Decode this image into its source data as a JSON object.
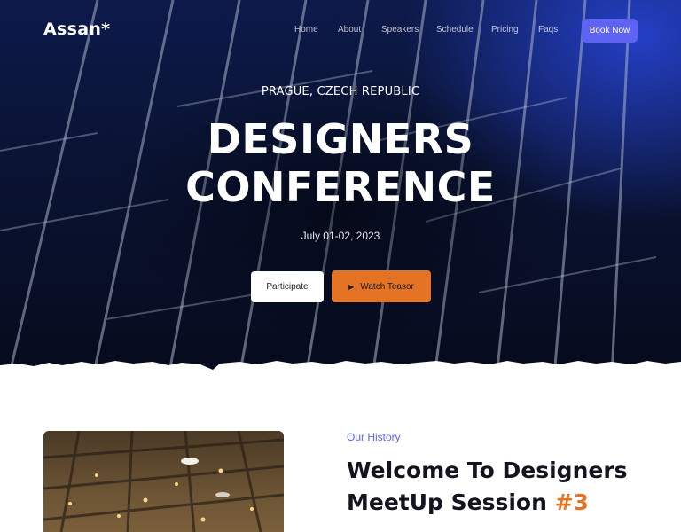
{
  "nav": {
    "logo": "Assan*",
    "items": [
      "Home",
      "About",
      "Speakers",
      "Schedule",
      "Pricing",
      "Faqs"
    ],
    "cta_label": "Book Now"
  },
  "hero": {
    "location": "PRAGUE, CZECH REPUBLIC",
    "title_line1": "DESIGNERS",
    "title_line2": "CONFERENCE",
    "date": "July 01-02, 2023",
    "primary_button": "Participate",
    "secondary_button": "Watch Teasor",
    "secondary_icon": "play-icon"
  },
  "history": {
    "label": "Our History",
    "title_line1": "Welcome To Designers",
    "title_line2_prefix": "MeetUp Session ",
    "title_accent": "#3"
  },
  "colors": {
    "accent": "#5f63f2",
    "orange": "#e57326",
    "hero_dark": "#0a1333"
  }
}
